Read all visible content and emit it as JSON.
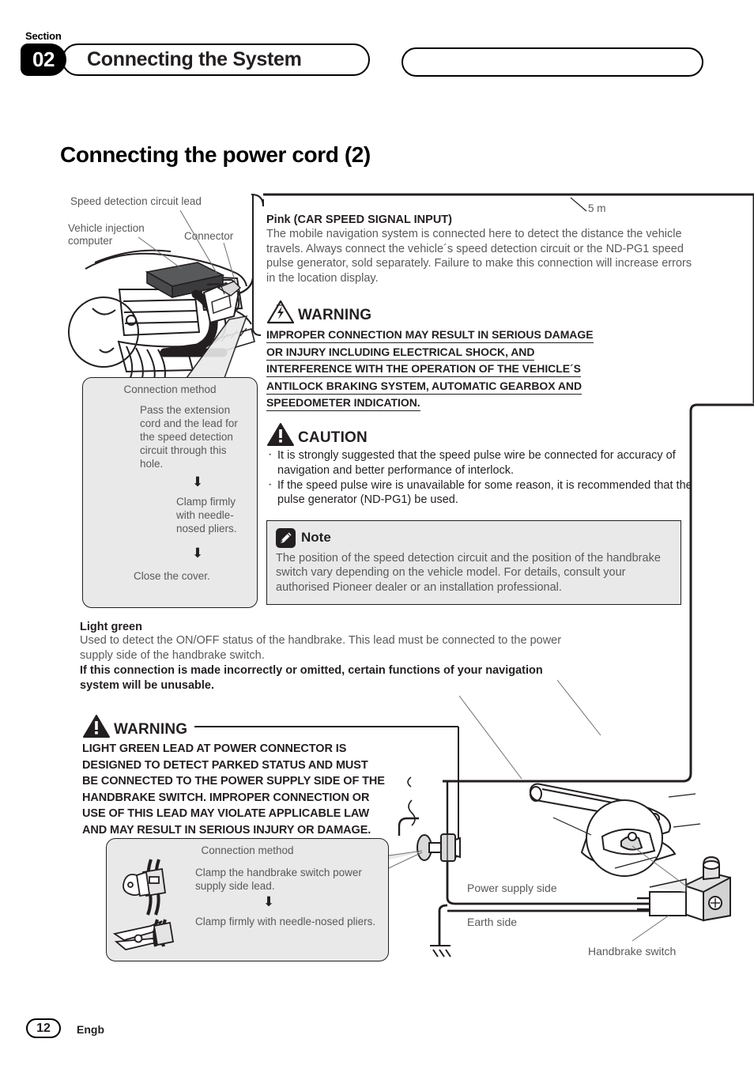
{
  "header": {
    "section_word": "Section",
    "section_number": "02",
    "title": "Connecting the System",
    "blank_pill": ""
  },
  "page_title": "Connecting the power cord (2)",
  "illustration_labels": {
    "speed_detection_circuit_lead": "Speed detection circuit lead",
    "vehicle_injection_computer": "Vehicle injection\ncomputer",
    "connector": "Connector",
    "length_5m": "5 m"
  },
  "pink_section": {
    "heading": "Pink (CAR SPEED SIGNAL INPUT)",
    "body": "The mobile navigation system is connected here to detect the distance the vehicle travels. Always connect the vehicle´s speed detection circuit or the ND-PG1 speed pulse generator, sold separately. Failure to make this connection will increase errors in the location display."
  },
  "warning_1": {
    "icon": "electric-shock-triangle-icon",
    "title": "WARNING",
    "lines": [
      "IMPROPER CONNECTION MAY RESULT IN SERIOUS DAMAGE",
      "OR INJURY INCLUDING ELECTRICAL SHOCK, AND",
      "INTERFERENCE WITH THE OPERATION OF THE VEHICLE´S",
      "ANTILOCK BRAKING SYSTEM, AUTOMATIC GEARBOX AND",
      "SPEEDOMETER INDICATION."
    ]
  },
  "caution": {
    "icon": "caution-triangle-icon",
    "title": "CAUTION",
    "items": [
      "It is strongly suggested that the speed pulse wire be connected for accuracy of navigation and better performance of interlock.",
      "If the speed pulse wire is unavailable for some reason, it is recommended that the pulse generator (ND-PG1) be used."
    ]
  },
  "note": {
    "icon": "pencil-note-icon",
    "title": "Note",
    "body": "The position of the speed detection circuit and the position of the handbrake switch vary depending on the vehicle model. For details, consult your authorised Pioneer dealer or an installation professional."
  },
  "connection_method_1": {
    "title": "Connection method",
    "steps": [
      "Pass the extension cord and the lead for the speed detection circuit through this hole.",
      "Clamp firmly with needle-nosed pliers.",
      "Close the cover."
    ],
    "arrow": "⬇"
  },
  "light_green": {
    "heading": "Light green",
    "body": "Used to detect the ON/OFF status of the handbrake. This lead must be connected to the power supply side of the handbrake switch.",
    "bold_note": "If this connection is made incorrectly or omitted, certain functions of your navigation system will be unusable."
  },
  "warning_2": {
    "icon": "caution-triangle-icon",
    "title": "WARNING",
    "lines": [
      "LIGHT GREEN LEAD AT POWER CONNECTOR IS",
      "DESIGNED TO DETECT PARKED STATUS AND MUST",
      "BE CONNECTED TO THE POWER SUPPLY SIDE OF THE",
      "HANDBRAKE SWITCH. IMPROPER CONNECTION OR",
      "USE OF THIS LEAD MAY VIOLATE APPLICABLE LAW",
      "AND MAY RESULT IN SERIOUS INJURY OR DAMAGE."
    ]
  },
  "connection_method_2": {
    "title": "Connection method",
    "steps": [
      "Clamp the handbrake switch power supply side lead.",
      "Clamp firmly with needle-nosed pliers."
    ],
    "arrow": "⬇"
  },
  "wiring_labels": {
    "power_supply_side": "Power supply side",
    "earth_side": "Earth side",
    "handbrake_switch": "Handbrake switch"
  },
  "footer": {
    "page_number": "12",
    "language": "Engb"
  },
  "colors": {
    "ink": "#231f20",
    "body_grey": "#58595b",
    "panel_grey": "#e9e9e9",
    "black": "#000000"
  }
}
